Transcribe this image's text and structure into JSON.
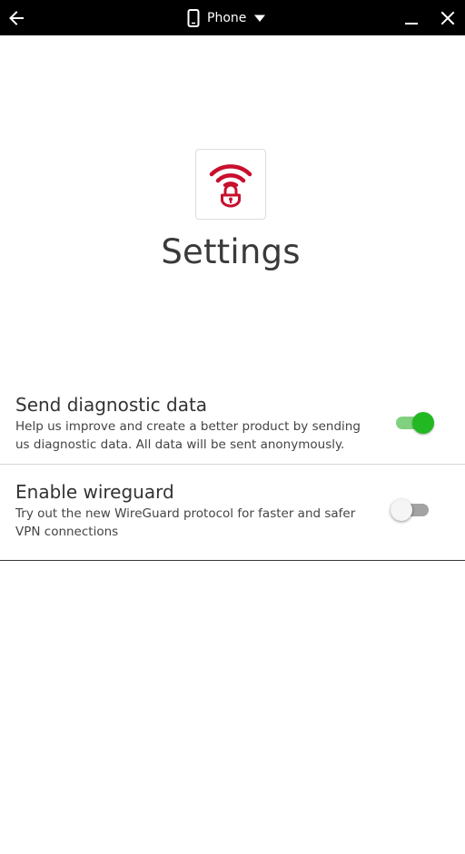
{
  "topbar": {
    "device_label": "Phone",
    "back_icon": "arrow-left-icon",
    "device_icon": "phone-icon",
    "dropdown_icon": "caret-down-icon",
    "minimize_icon": "minimize-icon",
    "close_icon": "close-icon"
  },
  "header": {
    "app_icon": "wifi-lock-icon",
    "title": "Settings"
  },
  "settings": [
    {
      "title": "Send diagnostic data",
      "description": "Help us improve and create a better product by sending us diagnostic data. All data will be sent anonymously.",
      "enabled": true
    },
    {
      "title": "Enable wireguard",
      "description": "Try out the new WireGuard protocol for faster and safer VPN connections",
      "enabled": false
    }
  ],
  "colors": {
    "brand_red": "#c8102e",
    "toggle_on_thumb": "#22b822",
    "toggle_on_track": "#7fd17f",
    "toggle_off_track": "#a3a3a3"
  }
}
